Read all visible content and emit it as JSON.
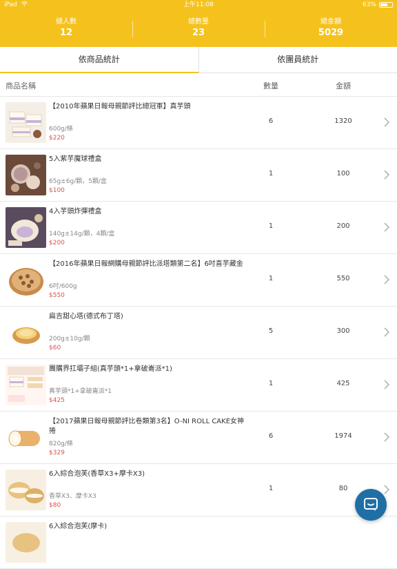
{
  "status_bar": {
    "carrier": "iPad",
    "time": "上午11:08",
    "battery": "63%",
    "battery_level": 0.63
  },
  "summary": [
    {
      "label": "總人數",
      "value": "12"
    },
    {
      "label": "總數量",
      "value": "23"
    },
    {
      "label": "總金額",
      "value": "5029"
    }
  ],
  "tabs": [
    {
      "label": "依商品統計",
      "active": true
    },
    {
      "label": "依團員統計",
      "active": false
    }
  ],
  "columns": {
    "name": "商品名稱",
    "qty": "數量",
    "amount": "金額"
  },
  "products": [
    {
      "name": "【2010年蘋果日報母親節評比總冠軍】真芋頭",
      "spec": "600g/條",
      "price": "$220",
      "qty": "6",
      "amount": "1320",
      "image": "taro-cake-slices"
    },
    {
      "name": "5入紫芋魔球禮盒",
      "spec": "65g±6g/顆，5顆/盒",
      "price": "$100",
      "qty": "1",
      "amount": "100",
      "image": "taro-balls"
    },
    {
      "name": "4入芋頭炸彈禮盒",
      "spec": "140g±14g/顆，4顆/盒",
      "price": "$200",
      "qty": "1",
      "amount": "200",
      "image": "taro-bomb"
    },
    {
      "name": "【2016年蘋果日報網購母親節評比派塔類第二名】6吋喜芋藏金",
      "spec": "6吋/600g",
      "price": "$550",
      "qty": "1",
      "amount": "550",
      "image": "nut-tart"
    },
    {
      "name": "扁吉甜心塔(德式布丁塔)",
      "spec": "200g±10g/顆",
      "price": "$60",
      "qty": "5",
      "amount": "300",
      "image": "pudding-tart"
    },
    {
      "name": "團購界扛壩子組(真芋頭*1+拿破崙派*1)",
      "spec": "真芋頭*1+拿破崙派*1",
      "price": "$425",
      "qty": "1",
      "amount": "425",
      "image": "combo-set"
    },
    {
      "name": "【2017蘋果日報母親節評比卷類第3名】O-NI ROLL CAKE女神捲",
      "spec": "820g/條",
      "price": "$329",
      "qty": "6",
      "amount": "1974",
      "image": "roll-cake"
    },
    {
      "name": "6入綜合泡芙(香草X3+摩卡X3)",
      "spec": "香草X3、摩卡X3",
      "price": "$80",
      "qty": "1",
      "amount": "80",
      "image": "cream-puffs"
    },
    {
      "name": "6入綜合泡芙(摩卡)",
      "spec": "",
      "price": "",
      "qty": "",
      "amount": "",
      "image": "cream-puff"
    }
  ],
  "colors": {
    "brand": "#f5c21d",
    "price": "#d9534f",
    "chat_button": "#1f6fa6"
  },
  "icons": {
    "chevron": "chevron-right-icon",
    "chat": "chat-icon",
    "wifi": "wifi-icon",
    "battery": "battery-icon"
  }
}
